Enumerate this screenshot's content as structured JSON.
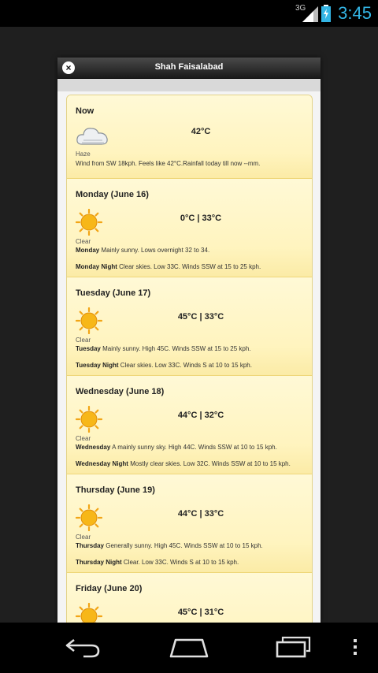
{
  "status_bar": {
    "network": "3G",
    "time": "3:45"
  },
  "dialog": {
    "title": "Shah Faisalabad",
    "close_icon": "×"
  },
  "now": {
    "title": "Now",
    "temp": "42°C",
    "condition": "Haze",
    "detail": "Wind from SW 18kph. Feels like 42°C.Rainfall today till now --mm.",
    "icon": "cloud-icon"
  },
  "days": [
    {
      "title": "Monday (June 16)",
      "temp": "0°C | 33°C",
      "condition": "Clear",
      "day_label": "Monday",
      "day_text": "Mainly sunny. Lows overnight 32 to 34.",
      "night_label": "Monday Night",
      "night_text": "Clear skies. Low 33C. Winds SSW at 15 to 25 kph.",
      "icon": "sun-icon"
    },
    {
      "title": "Tuesday (June 17)",
      "temp": "45°C | 33°C",
      "condition": "Clear",
      "day_label": "Tuesday",
      "day_text": "Mainly sunny. High 45C. Winds SSW at 15 to 25 kph.",
      "night_label": "Tuesday Night",
      "night_text": "Clear skies. Low 33C. Winds S at 10 to 15 kph.",
      "icon": "sun-icon"
    },
    {
      "title": "Wednesday (June 18)",
      "temp": "44°C | 32°C",
      "condition": "Clear",
      "day_label": "Wednesday",
      "day_text": "A mainly sunny sky. High 44C. Winds SSW at 10 to 15 kph.",
      "night_label": "Wednesday Night",
      "night_text": "Mostly clear skies. Low 32C. Winds SSW at 10 to 15 kph.",
      "icon": "sun-icon"
    },
    {
      "title": "Thursday (June 19)",
      "temp": "44°C | 33°C",
      "condition": "Clear",
      "day_label": "Thursday",
      "day_text": "Generally sunny. High 45C. Winds SSW at 10 to 15 kph.",
      "night_label": "Thursday Night",
      "night_text": "Clear. Low 33C. Winds S at 10 to 15 kph.",
      "icon": "sun-icon"
    },
    {
      "title": "Friday (June 20)",
      "temp": "45°C | 31°C",
      "condition": "",
      "day_label": "",
      "day_text": "",
      "night_label": "",
      "night_text": "",
      "icon": "sun-icon"
    }
  ],
  "nav_bar": {
    "back": "back-icon",
    "home": "home-icon",
    "recent": "recent-apps-icon",
    "menu": "menu-icon"
  },
  "colors": {
    "accent_time": "#33b5e5",
    "card_bg": "#fff6c2",
    "sun": "#f7b718"
  }
}
